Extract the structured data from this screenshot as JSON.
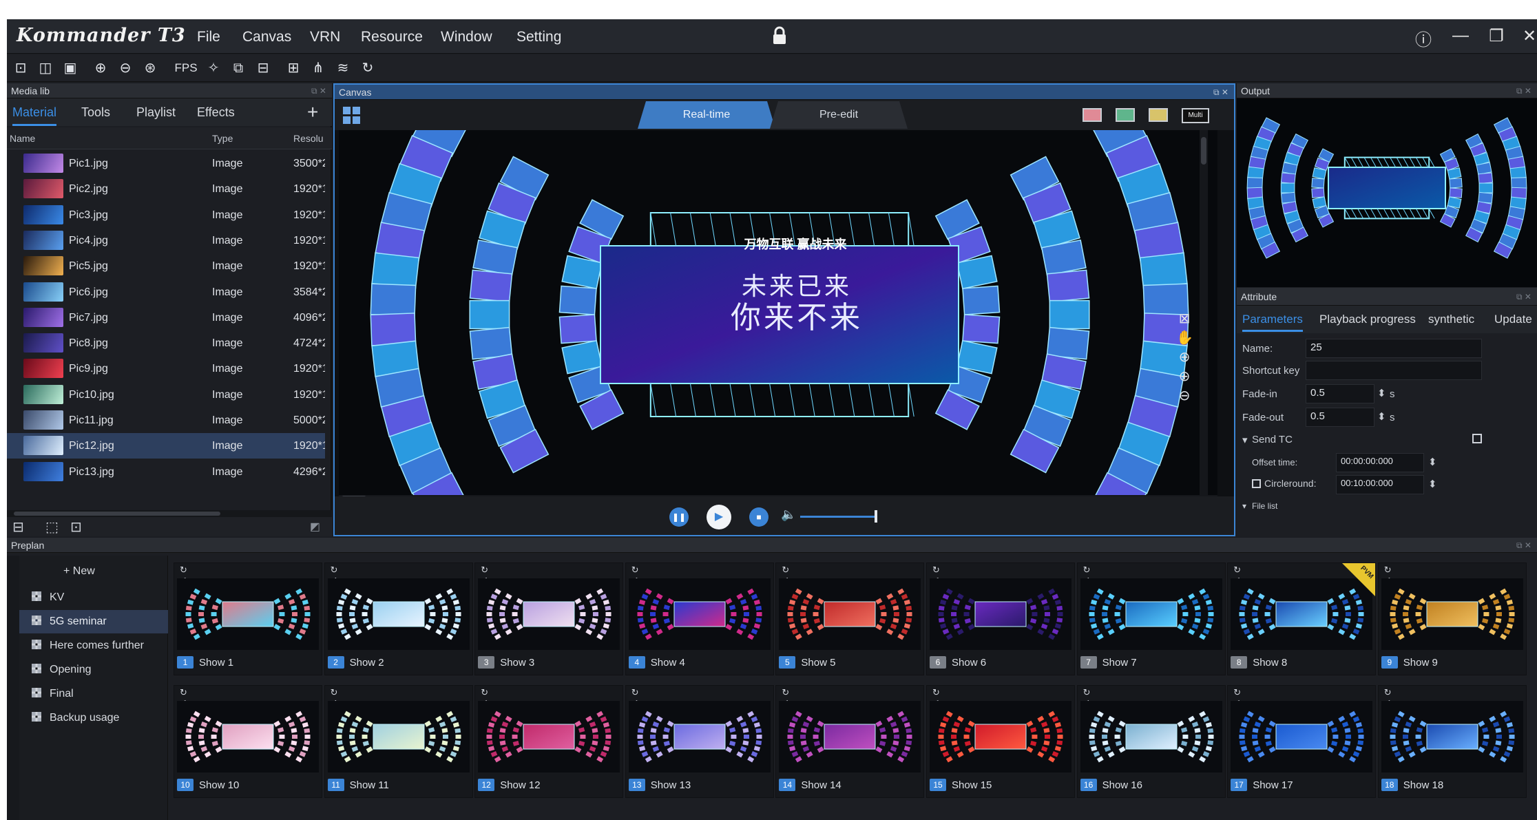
{
  "app": {
    "title": "Kommander T3"
  },
  "menu": [
    "File",
    "Canvas",
    "VRN",
    "Resource",
    "Window",
    "Setting"
  ],
  "toolbar": {
    "icons": [
      "new-icon",
      "open-icon",
      "save-icon",
      "zoom-in-icon",
      "zoom-out-icon",
      "zoom-fit-icon",
      "fps-icon",
      "brightness-icon",
      "screen-icon",
      "monitor-icon",
      "layout-icon",
      "topology-icon",
      "layers-icon",
      "refresh-icon"
    ],
    "fps_label": "FPS"
  },
  "medialib": {
    "title": "Media lib",
    "tabs": [
      "Material",
      "Tools",
      "Playlist",
      "Effects"
    ],
    "add": "+",
    "columns": [
      "Name",
      "Type",
      "Resolu"
    ],
    "rows": [
      {
        "name": "Pic1.jpg",
        "type": "Image",
        "res": "3500*2"
      },
      {
        "name": "Pic2.jpg",
        "type": "Image",
        "res": "1920*1"
      },
      {
        "name": "Pic3.jpg",
        "type": "Image",
        "res": "1920*1"
      },
      {
        "name": "Pic4.jpg",
        "type": "Image",
        "res": "1920*1"
      },
      {
        "name": "Pic5.jpg",
        "type": "Image",
        "res": "1920*1"
      },
      {
        "name": "Pic6.jpg",
        "type": "Image",
        "res": "3584*2"
      },
      {
        "name": "Pic7.jpg",
        "type": "Image",
        "res": "4096*2"
      },
      {
        "name": "Pic8.jpg",
        "type": "Image",
        "res": "4724*2"
      },
      {
        "name": "Pic9.jpg",
        "type": "Image",
        "res": "1920*1"
      },
      {
        "name": "Pic10.jpg",
        "type": "Image",
        "res": "1920*1"
      },
      {
        "name": "Pic11.jpg",
        "type": "Image",
        "res": "5000*2"
      },
      {
        "name": "Pic12.jpg",
        "type": "Image",
        "res": "1920*1"
      },
      {
        "name": "Pic13.jpg",
        "type": "Image",
        "res": "4296*2"
      }
    ],
    "selected_index": 11
  },
  "canvas": {
    "title": "Canvas",
    "modes": [
      "Real-time",
      "Pre-edit"
    ],
    "active_mode": "Real-time",
    "multi_label": "Multi",
    "stage_text_top": "万物互联 赢战未来",
    "stage_text_line1": "未来已来",
    "stage_text_line2": "你来不来"
  },
  "output": {
    "title": "Output"
  },
  "attribute": {
    "title": "Attribute",
    "tabs": [
      "Parameters",
      "Playback progress",
      "synthetic",
      "Update"
    ],
    "name_label": "Name:",
    "name_value": "25",
    "shortcut_label": "Shortcut key",
    "fadein_label": "Fade-in",
    "fadein_value": "0.5",
    "fadeout_label": "Fade-out",
    "fadeout_value": "0.5",
    "unit_s": "s",
    "sendtc_label": "Send TC",
    "offset_label": "Offset time:",
    "offset_value": "00:00:00:000",
    "circle_label": "Circleround:",
    "circle_value": "00:10:00:000",
    "filelist_label": "File list"
  },
  "preplan": {
    "title": "Preplan",
    "new_label": "+ New",
    "lists": [
      "KV",
      "5G seminar",
      "Here comes further",
      "Opening",
      "Final",
      "Backup usage"
    ],
    "selected_list": 1,
    "shows": [
      {
        "num": "1",
        "label": "Show 1"
      },
      {
        "num": "2",
        "label": "Show 2"
      },
      {
        "num": "3",
        "label": "Show 3"
      },
      {
        "num": "4",
        "label": "Show 4"
      },
      {
        "num": "5",
        "label": "Show 5"
      },
      {
        "num": "6",
        "label": "Show 6"
      },
      {
        "num": "7",
        "label": "Show 7"
      },
      {
        "num": "8",
        "label": "Show 8"
      },
      {
        "num": "9",
        "label": "Show 9"
      },
      {
        "num": "10",
        "label": "Show 10"
      },
      {
        "num": "11",
        "label": "Show 11"
      },
      {
        "num": "12",
        "label": "Show 12"
      },
      {
        "num": "13",
        "label": "Show 13"
      },
      {
        "num": "14",
        "label": "Show 14"
      },
      {
        "num": "15",
        "label": "Show 15"
      },
      {
        "num": "16",
        "label": "Show 16"
      },
      {
        "num": "17",
        "label": "Show 17"
      },
      {
        "num": "18",
        "label": "Show 18"
      }
    ],
    "pvm_badge": "PVM"
  },
  "colors": {
    "accent": "#3b8fe6",
    "selected_row": "#2d3f5e",
    "pvm": "#e8c62e"
  }
}
